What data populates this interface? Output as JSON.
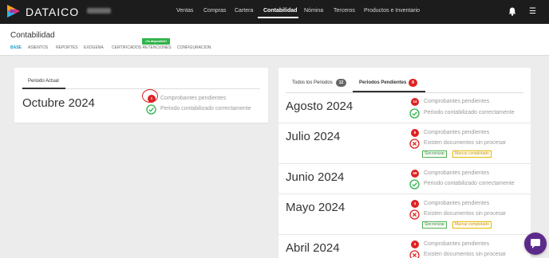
{
  "app": {
    "brand": "DATAICO"
  },
  "nav": {
    "items": [
      {
        "label": "Ventas"
      },
      {
        "label": "Compras"
      },
      {
        "label": "Cartera"
      },
      {
        "label": "Contabilidad",
        "active": true
      },
      {
        "label": "Nómina"
      },
      {
        "label": "Terceros"
      },
      {
        "label": "Productos e Inventario"
      }
    ]
  },
  "header": {
    "title": "Contabilidad",
    "tabs": [
      {
        "label": "BASE",
        "active": true
      },
      {
        "label": "ASIENTOS"
      },
      {
        "label": "REPORTES"
      },
      {
        "label": "EXOGENA"
      },
      {
        "label": "CERTIFICADOS RETENCIONES"
      },
      {
        "label": "CONFIGURACION"
      }
    ],
    "new_badge": "¡Ya disponible!"
  },
  "current_period": {
    "tab_label": "Periodo Actual",
    "month": "Octubre 2024",
    "pending_count": "1",
    "pending_text": "Comprobantes pendientes",
    "ok_text": "Periodo contabilizado correctamente"
  },
  "periods_panel": {
    "tab_all": {
      "label": "Todos los Periodos",
      "count": "12"
    },
    "tab_pending": {
      "label": "Periodos Pendientes",
      "count": "8"
    },
    "sync_label": "Sincronizar",
    "mark_label": "Marcar completado",
    "rows": [
      {
        "month": "Agosto 2024",
        "pending_count": "14",
        "pending_text": "Comprobantes pendientes",
        "status_text": "Periodo contabilizado correctamente",
        "status": "ok"
      },
      {
        "month": "Julio 2024",
        "pending_count": "8",
        "pending_text": "Comprobantes pendientes",
        "status_text": "Existen documentos sin procesar",
        "status": "error"
      },
      {
        "month": "Junio 2024",
        "pending_count": "59",
        "pending_text": "Comprobantes pendientes",
        "status_text": "Periodo contabilizado correctamente",
        "status": "ok"
      },
      {
        "month": "Mayo 2024",
        "pending_count": "3",
        "pending_text": "Comprobantes pendientes",
        "status_text": "Existen documentos sin procesar",
        "status": "error"
      },
      {
        "month": "Abril 2024",
        "pending_count": "3",
        "pending_text": "Comprobantes pendientes",
        "status_text": "Existen documentos sin procesar",
        "status": "error"
      }
    ]
  },
  "colors": {
    "topbar": "#1c1c1c",
    "accent": "#1e9bc4",
    "danger": "#dd2222",
    "success": "#2fb34a",
    "warning": "#e6b800",
    "chat": "#5c2a8a"
  },
  "icons": {
    "logo": "dataico-logo-icon",
    "bell": "bell-icon",
    "menu": "hamburger-menu-icon",
    "ok": "check-circle-icon",
    "error": "x-circle-icon",
    "chat": "chat-icon"
  }
}
